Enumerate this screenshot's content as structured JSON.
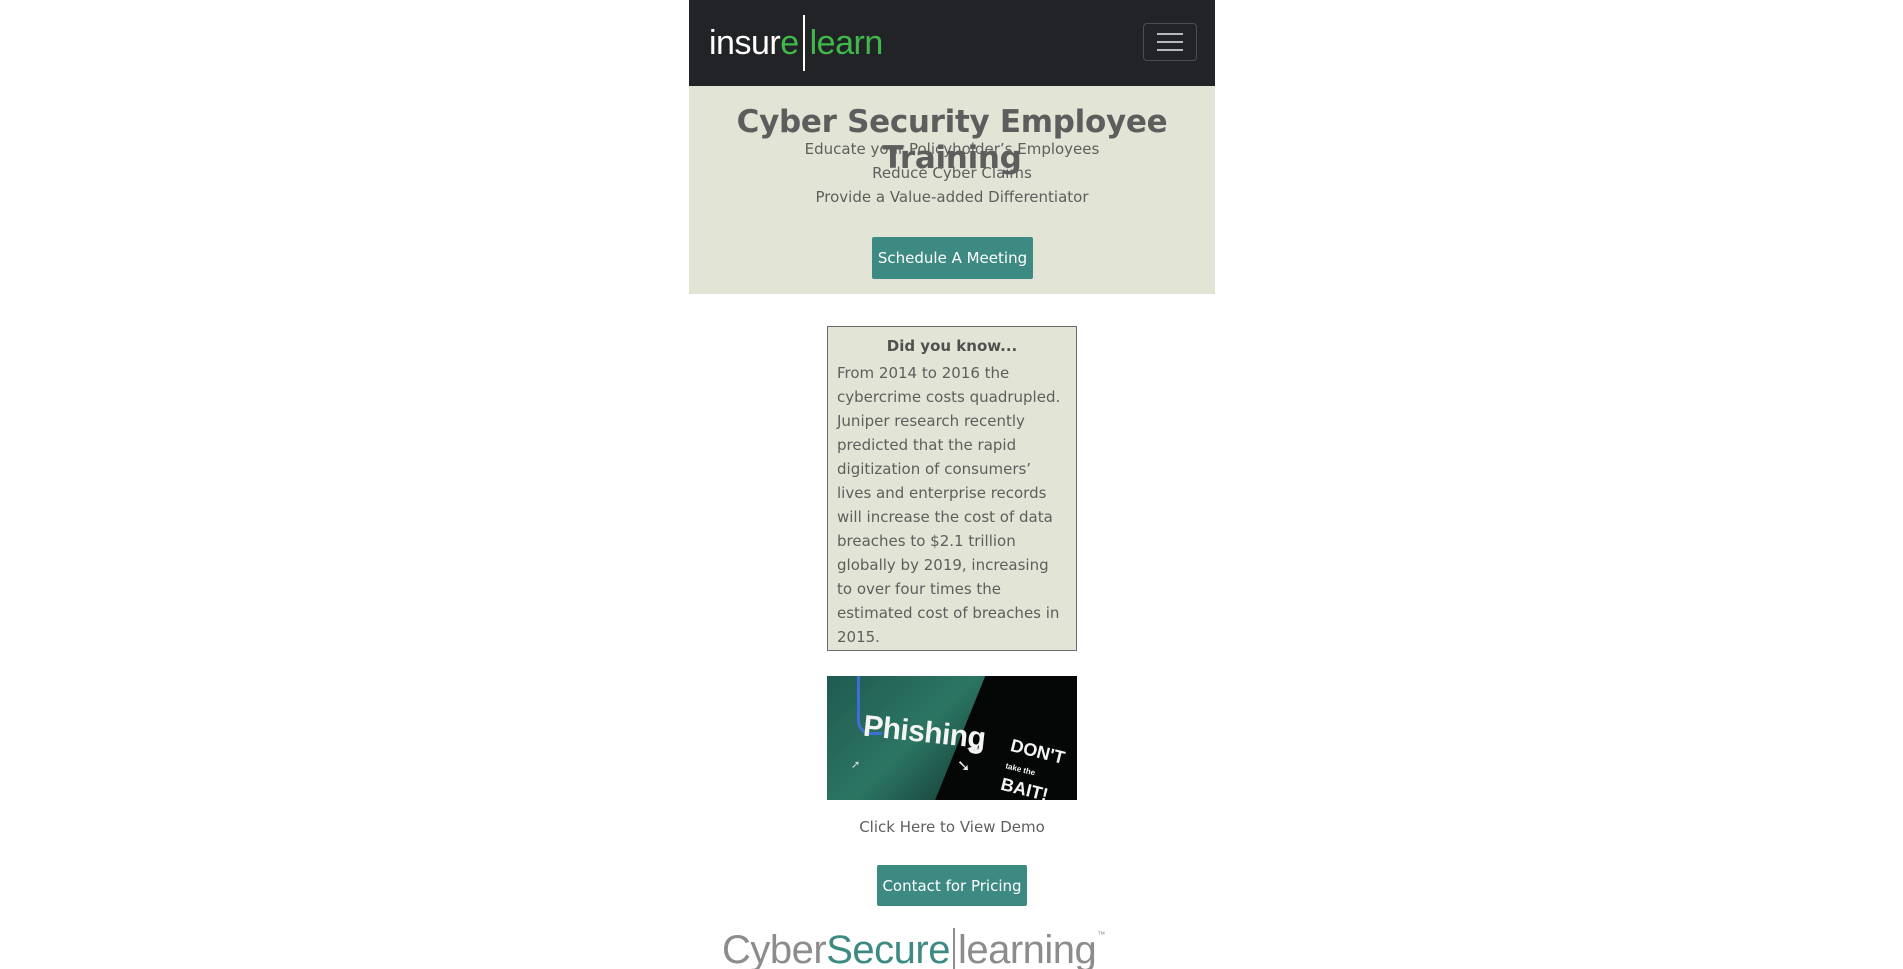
{
  "nav": {
    "logo": {
      "part1": "insur",
      "part2": "e",
      "part3": "learn"
    },
    "menu_icon": "hamburger-icon"
  },
  "hero": {
    "title": "Cyber Security Employee Training",
    "lines": [
      "Educate your Policyholder’s Employees",
      "Reduce Cyber Claims",
      "Provide a Value-added Differentiator"
    ],
    "cta_label": "Schedule A Meeting"
  },
  "fact": {
    "title": "Did you know...",
    "text": "From 2014 to 2016 the cybercrime costs quadrupled. Juniper research recently predicted that the rapid digitization of consumers’ lives and enterprise records will increase the cost of data breaches to $2.1 trillion globally by 2019, increasing to over four times the estimated cost of breaches in 2015."
  },
  "demo": {
    "image": {
      "headline": "Phishing",
      "tagline_1": "DON'T",
      "tagline_2": "take the",
      "tagline_3": "BAIT!"
    },
    "link_label": "Click Here to View Demo"
  },
  "pricing": {
    "label": "Contact for Pricing"
  },
  "footer_logo": {
    "part1": "Cyber",
    "part2": "Secure",
    "part3": "learning",
    "tm": "™"
  },
  "colors": {
    "navbar_bg": "#222327",
    "accent_green": "#3fb949",
    "hero_bg": "#e2e4d5",
    "button_teal": "#3c8a82"
  }
}
